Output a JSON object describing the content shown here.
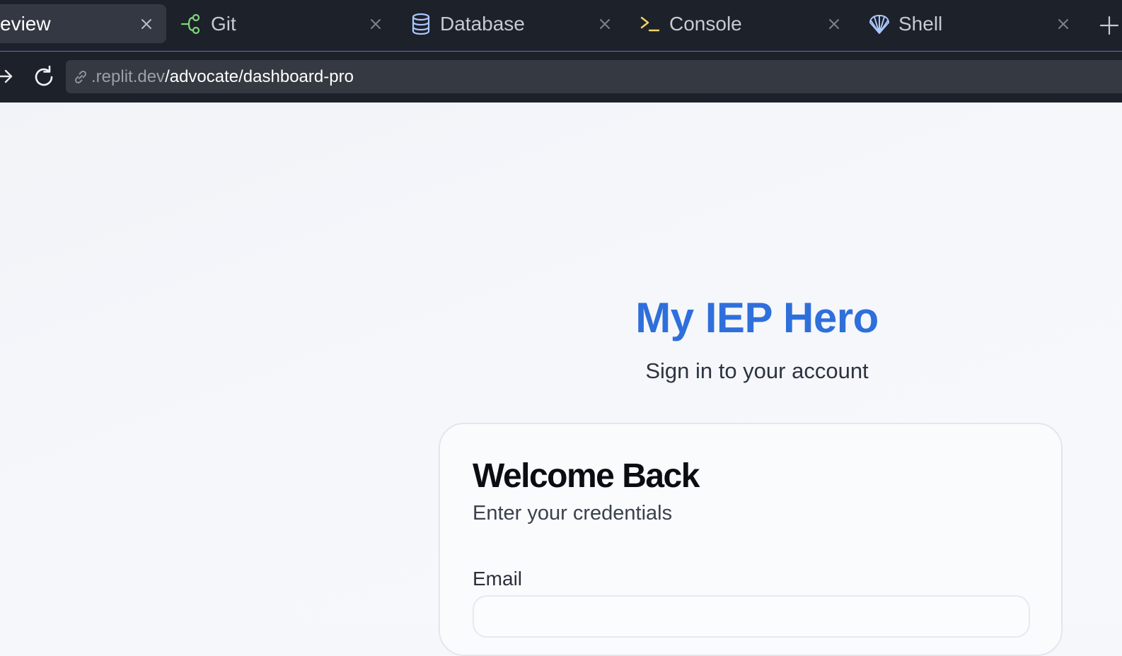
{
  "tabs": [
    {
      "label": "eview",
      "icon": "preview",
      "active": true
    },
    {
      "label": "Git",
      "icon": "git-icon",
      "active": false
    },
    {
      "label": "Database",
      "icon": "database-icon",
      "active": false
    },
    {
      "label": "Console",
      "icon": "console-icon",
      "active": false
    },
    {
      "label": "Shell",
      "icon": "shell-icon",
      "active": false
    }
  ],
  "address": {
    "domain": ".replit.dev",
    "path": "/advocate/dashboard-pro"
  },
  "login": {
    "brand": "My IEP Hero",
    "subtitle": "Sign in to your account",
    "card_title": "Welcome Back",
    "card_desc": "Enter your credentials",
    "email_label": "Email",
    "email_value": ""
  },
  "colors": {
    "brand": "#2f6fdb",
    "git_icon": "#7ed67b",
    "database_icon": "#a9c8ff",
    "console_icon": "#f1d36a",
    "shell_icon": "#a9c8ff"
  }
}
